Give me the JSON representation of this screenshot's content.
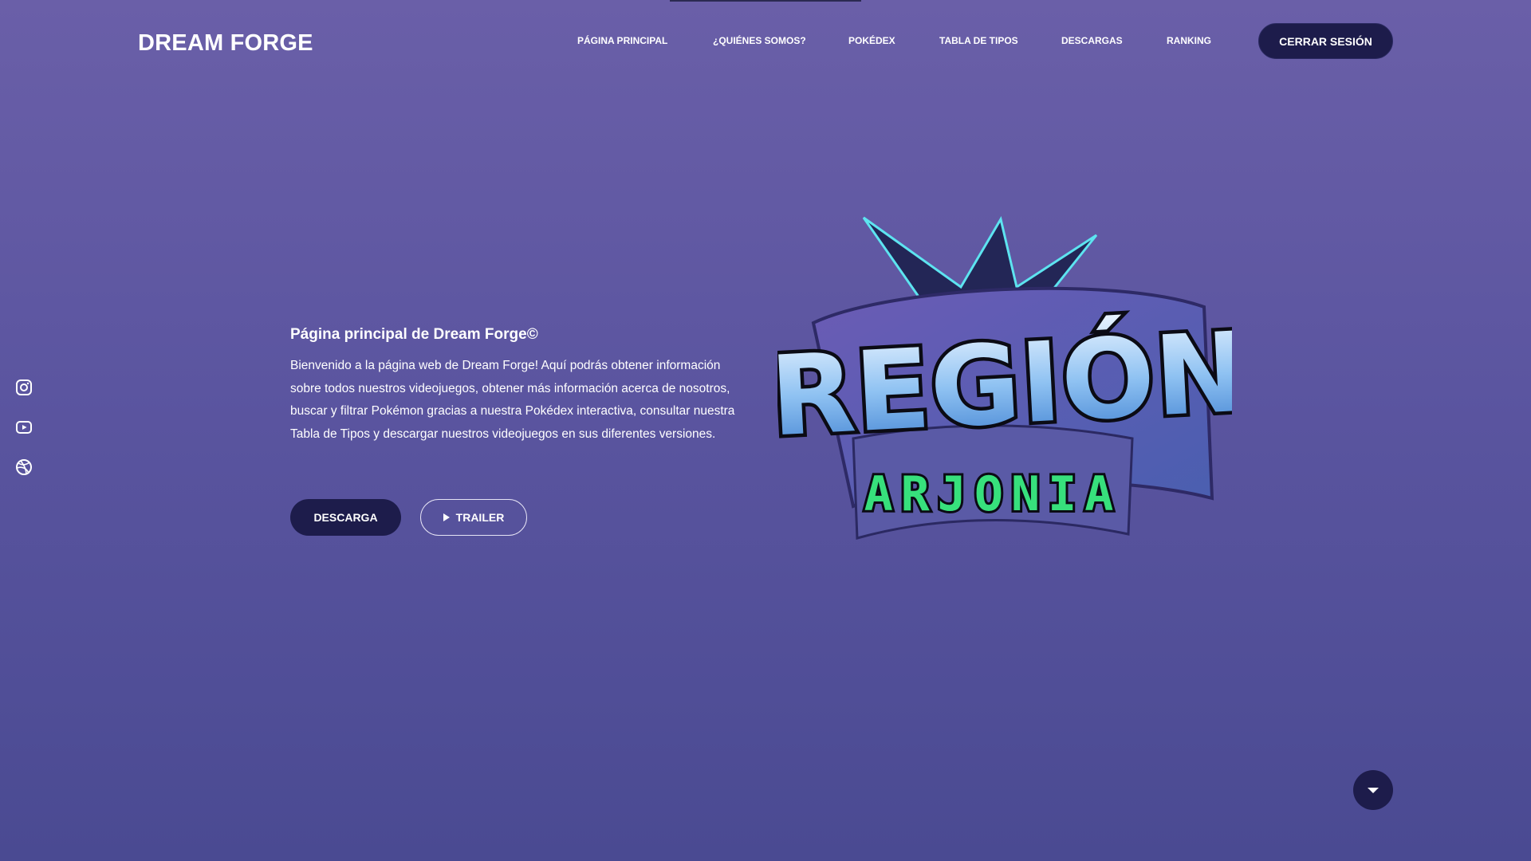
{
  "header": {
    "brand": "DREAM FORGE",
    "nav": [
      {
        "label": "PÁGINA PRINCIPAL"
      },
      {
        "label": "¿QUIÉNES SOMOS?"
      },
      {
        "label": "POKÉDEX"
      },
      {
        "label": "TABLA DE TIPOS"
      },
      {
        "label": "DESCARGAS"
      },
      {
        "label": "RANKING"
      }
    ],
    "logout_label": "CERRAR SESIÓN"
  },
  "social": [
    {
      "icon": "instagram-icon"
    },
    {
      "icon": "youtube-icon"
    },
    {
      "icon": "dribbble-icon"
    }
  ],
  "hero": {
    "title": "Página principal de Dream Forge©",
    "text": "Bienvenido a la página web de Dream Forge! Aquí podrás obtener información sobre todos nuestros videojuegos, obtener más información acerca de nosotros, buscar y filtrar Pokémon gracias a nuestra Pokédex interactiva, consultar nuestra Tabla de Tipos y descargar nuestros videojuegos en sus diferentes versiones.",
    "download_label": "DESCARGA",
    "trailer_label": "TRAILER"
  },
  "logo": {
    "line1": "REGIÓN",
    "line2": "ARJONIA"
  },
  "colors": {
    "button_dark": "#1d1c4b",
    "logo_green": "#37e07c",
    "logo_cyan": "#5de4f0"
  }
}
